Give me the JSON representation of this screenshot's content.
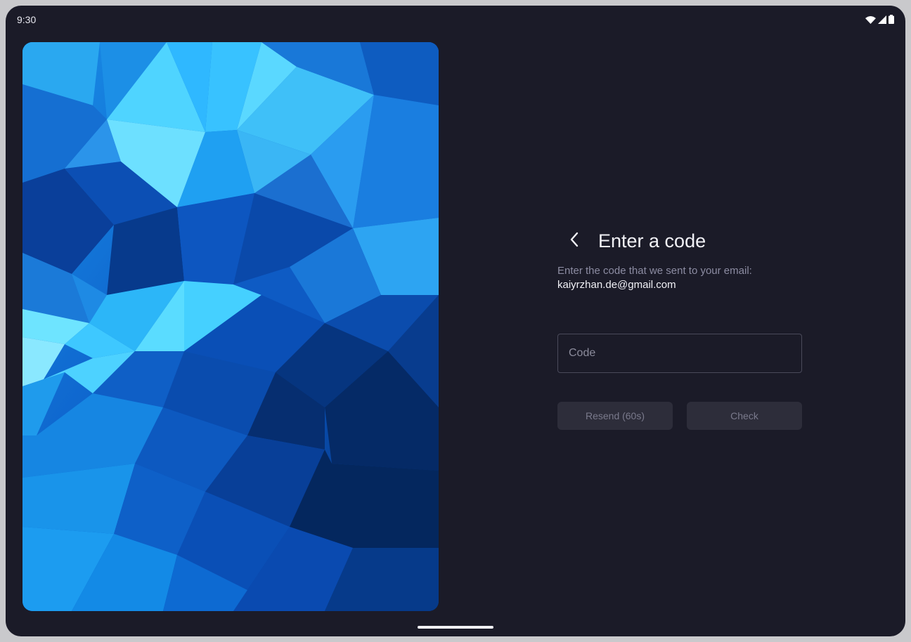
{
  "status_bar": {
    "time": "9:30",
    "icons": [
      "wifi-icon",
      "signal-icon",
      "battery-icon"
    ]
  },
  "hero": {
    "icon": "polygon-wallpaper",
    "colors": [
      "#0a4fb8",
      "#1e88e5",
      "#3fc8ff",
      "#0d3a8a",
      "#062c66"
    ]
  },
  "form": {
    "back_icon": "chevron-left-icon",
    "title": "Enter a code",
    "subtitle": "Enter the code that we sent to your email:",
    "email": "kaiyrzhan.de@gmail.com",
    "code_field": {
      "placeholder": "Code",
      "value": ""
    },
    "buttons": {
      "resend": "Resend (60s)",
      "check": "Check"
    }
  },
  "colors": {
    "background": "#1b1b28",
    "text_primary": "#f1f1f6",
    "text_secondary": "#8c8ca2",
    "button_bg": "#2d2d3a",
    "button_text": "#7a7a8c"
  }
}
